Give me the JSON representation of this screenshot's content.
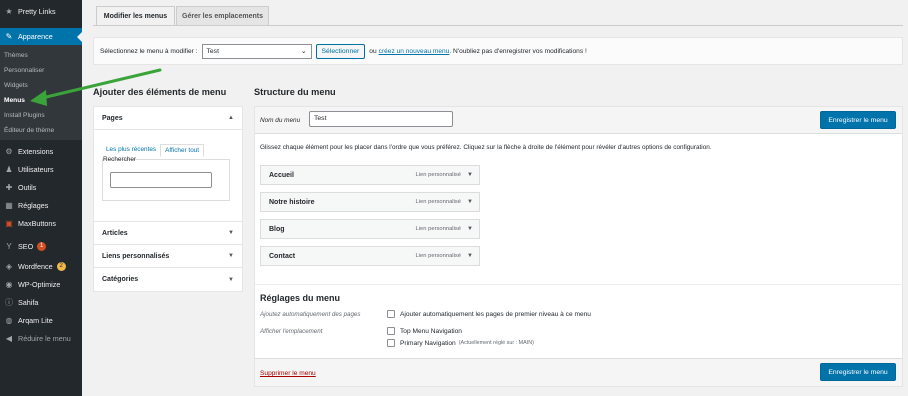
{
  "sidebar": {
    "top_item": {
      "label": "Pretty Links",
      "icon": "link-icon"
    },
    "active_item": {
      "label": "Apparence",
      "icon": "brush-icon"
    },
    "submenu": [
      "Thèmes",
      "Personnaliser",
      "Widgets",
      "Menus",
      "Install Plugins",
      "Éditeur de thème"
    ],
    "items": [
      {
        "label": "Extensions",
        "icon": "plugin-icon"
      },
      {
        "label": "Utilisateurs",
        "icon": "users-icon"
      },
      {
        "label": "Outils",
        "icon": "wrench-icon"
      },
      {
        "label": "Réglages",
        "icon": "settings-icon"
      },
      {
        "label": "MaxButtons",
        "icon": "grid-icon"
      },
      {
        "label": "SEO",
        "icon": "seo-icon",
        "badge": "1"
      },
      {
        "label": "Wordfence",
        "icon": "shield-icon",
        "badge": "2"
      },
      {
        "label": "WP-Optimize",
        "icon": "optimize-icon"
      },
      {
        "label": "Sahifa",
        "icon": "info-icon"
      },
      {
        "label": "Arqam Lite",
        "icon": "gauge-icon"
      },
      {
        "label": "Réduire le menu",
        "icon": "collapse-icon"
      }
    ]
  },
  "tabs": [
    "Modifier les menus",
    "Gérer les emplacements"
  ],
  "select_bar": {
    "label": "Sélectionnez le menu à modifier :",
    "selected": "Test",
    "button": "Sélectionner",
    "or": "ou",
    "create_link": "créez un nouveau menu",
    "note": ". N'oubliez pas d'enregistrer vos modifications !"
  },
  "left": {
    "heading": "Ajouter des éléments de menu",
    "sections": [
      "Pages",
      "Articles",
      "Liens personnalisés",
      "Catégories"
    ],
    "subtabs": [
      "Les plus récentes",
      "Afficher tout"
    ],
    "search_label": "Rechercher"
  },
  "right": {
    "heading": "Structure du menu",
    "name_label": "Nom du menu",
    "name_value": "Test",
    "save_button": "Enregistrer le menu",
    "instruction": "Glissez chaque élément pour les placer dans l'ordre que vous préférez. Cliquez sur la flèche à droite de l'élément pour révéler d'autres options de configuration.",
    "items": [
      {
        "title": "Accueil",
        "type": "Lien personnalisé"
      },
      {
        "title": "Notre histoire",
        "type": "Lien personnalisé"
      },
      {
        "title": "Blog",
        "type": "Lien personnalisé"
      },
      {
        "title": "Contact",
        "type": "Lien personnalisé"
      }
    ],
    "settings_title": "Réglages du menu",
    "auto_add_label": "Ajoutez automatiquement des pages",
    "auto_add_option": "Ajouter automatiquement les pages de premier niveau à ce menu",
    "location_label": "Afficher l'emplacement",
    "locations": [
      {
        "label": "Top Menu Navigation",
        "note": ""
      },
      {
        "label": "Primary Navigation",
        "note": "(Actuellement réglé sur : MAIN)"
      }
    ],
    "delete_link": "Supprimer le menu"
  },
  "colors": {
    "sidebar": "#23282d",
    "accent": "#0073aa",
    "annotation_arrow": "#3aa43a"
  }
}
